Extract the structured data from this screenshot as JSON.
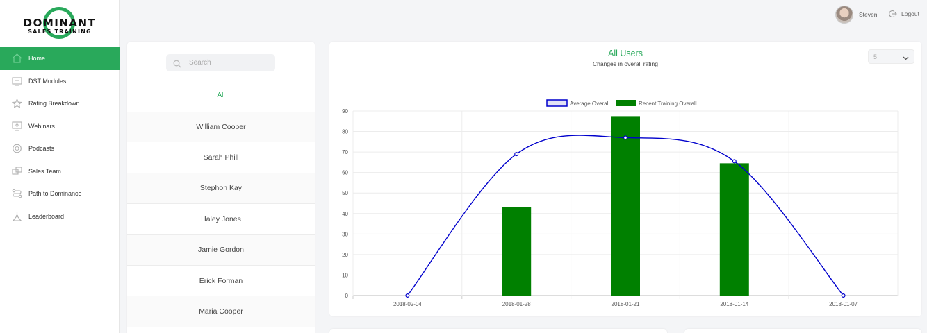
{
  "brand": {
    "name_top": "DOMINANT",
    "name_bottom": "SALES TRAINING",
    "accent": "#29a95b"
  },
  "header": {
    "username": "Steven",
    "logout_label": "Logout"
  },
  "sidebar": {
    "items": [
      {
        "label": "Home",
        "icon": "home-icon",
        "active": true
      },
      {
        "label": "DST Modules",
        "icon": "modules-icon"
      },
      {
        "label": "Rating Breakdown",
        "icon": "star-icon"
      },
      {
        "label": "Webinars",
        "icon": "webinar-icon"
      },
      {
        "label": "Podcasts",
        "icon": "podcast-icon"
      },
      {
        "label": "Sales Team",
        "icon": "team-icon"
      },
      {
        "label": "Path to Dominance",
        "icon": "path-icon"
      },
      {
        "label": "Leaderboard",
        "icon": "leaderboard-icon"
      }
    ]
  },
  "users_panel": {
    "search": {
      "placeholder": "Search",
      "value": ""
    },
    "all_label": "All",
    "users": [
      "William Cooper",
      "Sarah Phill",
      "Stephon Kay",
      "Haley Jones",
      "Jamie Gordon",
      "Erick Forman",
      "Maria Cooper"
    ]
  },
  "chart_panel": {
    "title": "All Users",
    "subtitle": "Changes in overall rating",
    "count_select": {
      "value": "5"
    }
  },
  "chart_data": {
    "type": "bar",
    "categories": [
      "2018-02-04",
      "2018-01-28",
      "2018-01-21",
      "2018-01-14",
      "2018-01-07"
    ],
    "series": [
      {
        "name": "Average Overall",
        "type": "line",
        "color": "#0000cc",
        "values": [
          0,
          69,
          77,
          65.5,
          0
        ]
      },
      {
        "name": "Recent Training Overall",
        "type": "bar",
        "color": "#008000",
        "values": [
          null,
          43,
          87.5,
          64.5,
          null
        ]
      }
    ],
    "ylim": [
      0,
      90
    ],
    "yticks": [
      0,
      10,
      20,
      30,
      40,
      50,
      60,
      70,
      80,
      90
    ],
    "grid": true,
    "legend": "top"
  }
}
